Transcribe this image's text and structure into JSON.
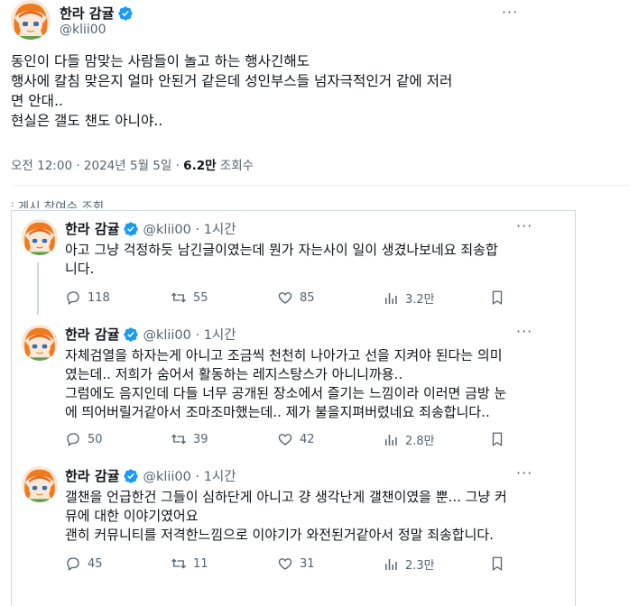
{
  "main_tweet": {
    "author_name": "한라 감귤",
    "handle": "@klii00",
    "more": "···",
    "lines": [
      "동인이 다들 맘맞는 사람들이 놀고 하는 행사긴해도",
      "행사에 칼침 맞은지 얼마 안된거 같은데 성인부스들 넘자극적인거 같에 저러",
      "면 안대..",
      "현실은 갤도 챈도 아니야.."
    ],
    "timestamp": "오전 12:00 · 2024년 5월 5일 · ",
    "views_count": "6.2만",
    "views_label": " 조회수",
    "engagements_label": "게시 참여수 조회"
  },
  "replies": [
    {
      "author_name": "한라 감귤",
      "handle": "@klii00 · 1시간",
      "lines": [
        "아고 그냥 걱정하듯 남긴글이였는데 뭔가 자는사이 일이 생겼나보네요 죄송합",
        "니다."
      ],
      "replies_count": "118",
      "reposts_count": "55",
      "likes_count": "85",
      "views_count": "3.2만"
    },
    {
      "author_name": "한라 감귤",
      "handle": "@klii00 · 1시간",
      "lines": [
        "자체검열을 하자는게 아니고 조금씩 천천히 나아가고 선을 지켜야 된다는 의미",
        "였는데.. 저희가 숨어서 활동하는 레지스탕스가 아니니까용..",
        "그럼에도 음지인데 다들 너무 공개된 장소에서 즐기는 느낌이라 이러면 금방 눈",
        "에 띄어버릴거같아서 조마조마했는데.. 제가 불을지펴버렸네요 죄송합니다.."
      ],
      "replies_count": "50",
      "reposts_count": "39",
      "likes_count": "42",
      "views_count": "2.8만"
    },
    {
      "author_name": "한라 감귤",
      "handle": "@klii00 · 1시간",
      "lines": [
        "갤챈을 언급한건 그들이 심하단게 아니고 걍 생각난게 갤챈이였을 뿐... 그냥 커",
        "뮤에 대한 이야기였어요",
        "괜히 커뮤니티를 저격한느낌으로 이야기가 와전된거같아서 정말 죄송합니다."
      ],
      "replies_count": "45",
      "reposts_count": "11",
      "likes_count": "31",
      "views_count": "2.3만"
    }
  ],
  "icons": {
    "verified": "verified-badge-icon",
    "reply": "reply-icon",
    "repost": "repost-icon",
    "like": "heart-icon",
    "views": "views-bar-chart-icon",
    "bookmark": "bookmark-icon",
    "more": "more-dots-icon"
  },
  "colors": {
    "verified_blue": "#1d9bf0",
    "text": "#0f1419",
    "secondary": "#536471",
    "border": "#cfd9de"
  }
}
